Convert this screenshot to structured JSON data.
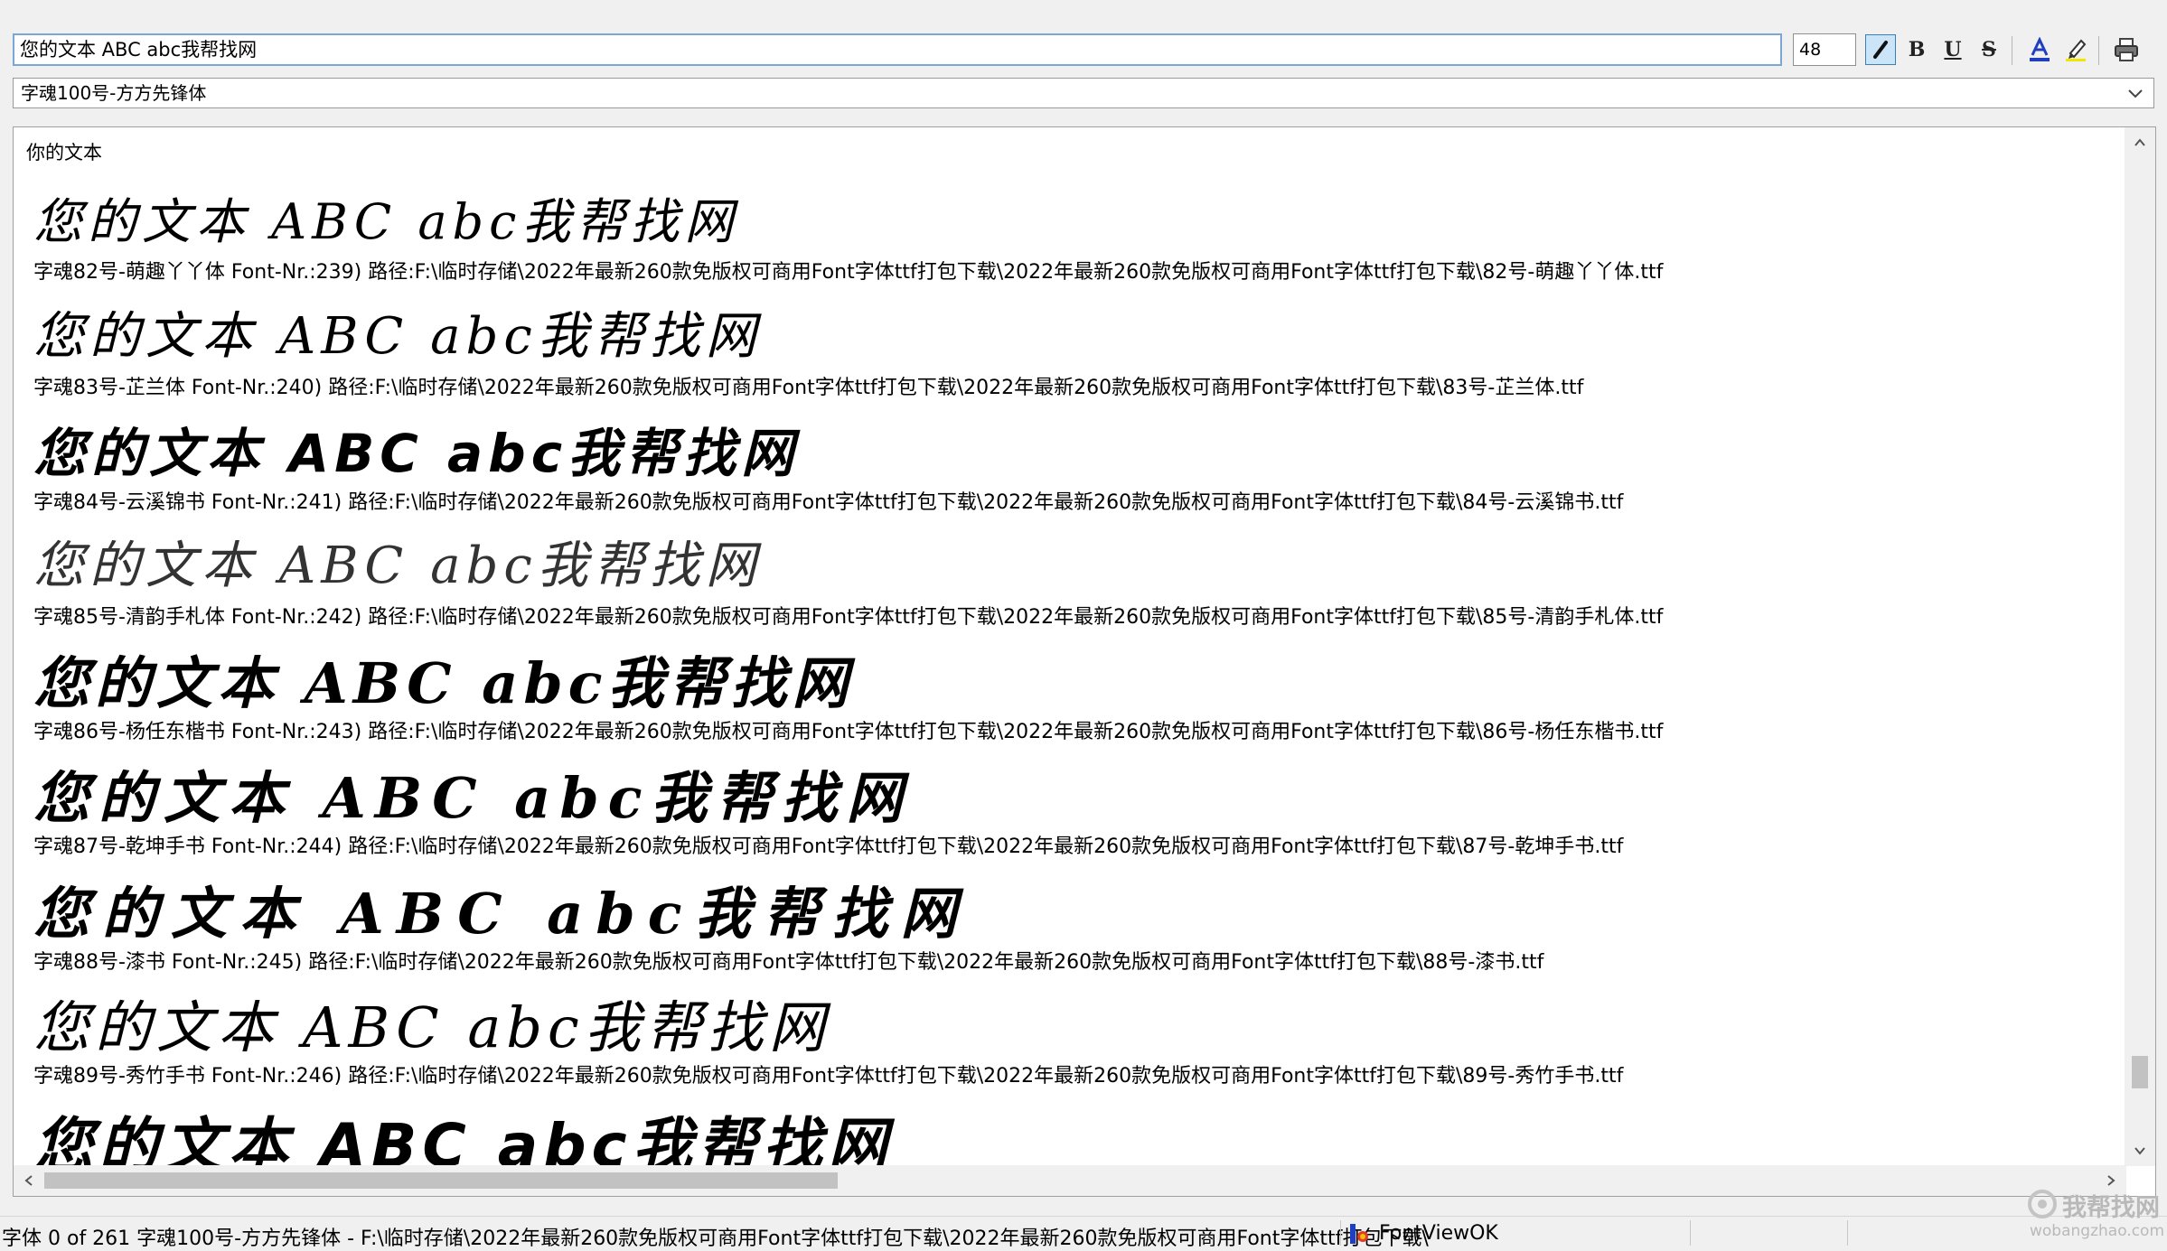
{
  "toolbar": {
    "text_value": "您的文本 ABC abc我帮找网",
    "size_value": "48",
    "italic_glyph": "I",
    "bold_glyph": "B",
    "underline_glyph": "U",
    "strike_glyph": "S",
    "font_color_glyph": "A"
  },
  "font_select": {
    "selected": "字魂100号-方方先锋体"
  },
  "preview": {
    "header": "你的文本",
    "entries": [
      {
        "sample": "您的文本 ABC abc我帮找网",
        "info": "字魂82号-萌趣丫丫体 Font-Nr.:239) 路径:F:\\临时存储\\2022年最新260款免版权可商用Font字体ttf打包下载\\2022年最新260款免版权可商用Font字体ttf打包下载\\82号-萌趣丫丫体.ttf"
      },
      {
        "sample": "您的文本 ABC abc我帮找网",
        "info": "字魂83号-芷兰体 Font-Nr.:240) 路径:F:\\临时存储\\2022年最新260款免版权可商用Font字体ttf打包下载\\2022年最新260款免版权可商用Font字体ttf打包下载\\83号-芷兰体.ttf"
      },
      {
        "sample": "您的文本 ABC abc我帮找网",
        "info": "字魂84号-云溪锦书 Font-Nr.:241) 路径:F:\\临时存储\\2022年最新260款免版权可商用Font字体ttf打包下载\\2022年最新260款免版权可商用Font字体ttf打包下载\\84号-云溪锦书.ttf"
      },
      {
        "sample": "您的文本 ABC abc我帮找网",
        "info": "字魂85号-清韵手札体 Font-Nr.:242) 路径:F:\\临时存储\\2022年最新260款免版权可商用Font字体ttf打包下载\\2022年最新260款免版权可商用Font字体ttf打包下载\\85号-清韵手札体.ttf"
      },
      {
        "sample": "您的文本 ABC abc我帮找网",
        "info": "字魂86号-杨任东楷书 Font-Nr.:243) 路径:F:\\临时存储\\2022年最新260款免版权可商用Font字体ttf打包下载\\2022年最新260款免版权可商用Font字体ttf打包下载\\86号-杨任东楷书.ttf"
      },
      {
        "sample": "您的文本 ABC abc我帮找网",
        "info": "字魂87号-乾坤手书 Font-Nr.:244) 路径:F:\\临时存储\\2022年最新260款免版权可商用Font字体ttf打包下载\\2022年最新260款免版权可商用Font字体ttf打包下载\\87号-乾坤手书.ttf"
      },
      {
        "sample": "您的文本 ABC abc我帮找网",
        "info": "字魂88号-漆书 Font-Nr.:245) 路径:F:\\临时存储\\2022年最新260款免版权可商用Font字体ttf打包下载\\2022年最新260款免版权可商用Font字体ttf打包下载\\88号-漆书.ttf"
      },
      {
        "sample": "您的文本 ABC abc我帮找网",
        "info": "字魂89号-秀竹手书 Font-Nr.:246) 路径:F:\\临时存储\\2022年最新260款免版权可商用Font字体ttf打包下载\\2022年最新260款免版权可商用Font字体ttf打包下载\\89号-秀竹手书.ttf"
      },
      {
        "sample": "您的文本 ABC abc我帮找网",
        "info": ""
      }
    ]
  },
  "status": {
    "text": "字体 0 of 261 字魂100号-方方先锋体 - F:\\临时存储\\2022年最新260款免版权可商用Font字体ttf打包下载\\2022年最新260款免版权可商用Font字体ttf打包下载\\",
    "app_name": "FontViewOK"
  },
  "watermark": {
    "main": "我帮找网",
    "sub": "wobangzhao.com"
  },
  "colors": {
    "accent_border": "#7aa7d6",
    "active_button": "#cce4f7",
    "font_color_bar": "#1f3fbf",
    "highlight_bar": "#f2e600"
  },
  "icons": [
    "italic-icon",
    "bold-icon",
    "underline-icon",
    "strikethrough-icon",
    "font-color-icon",
    "highlighter-icon",
    "printer-icon",
    "chevron-down-icon",
    "scroll-up-icon",
    "scroll-down-icon",
    "scroll-left-icon",
    "scroll-right-icon",
    "app-icon"
  ]
}
